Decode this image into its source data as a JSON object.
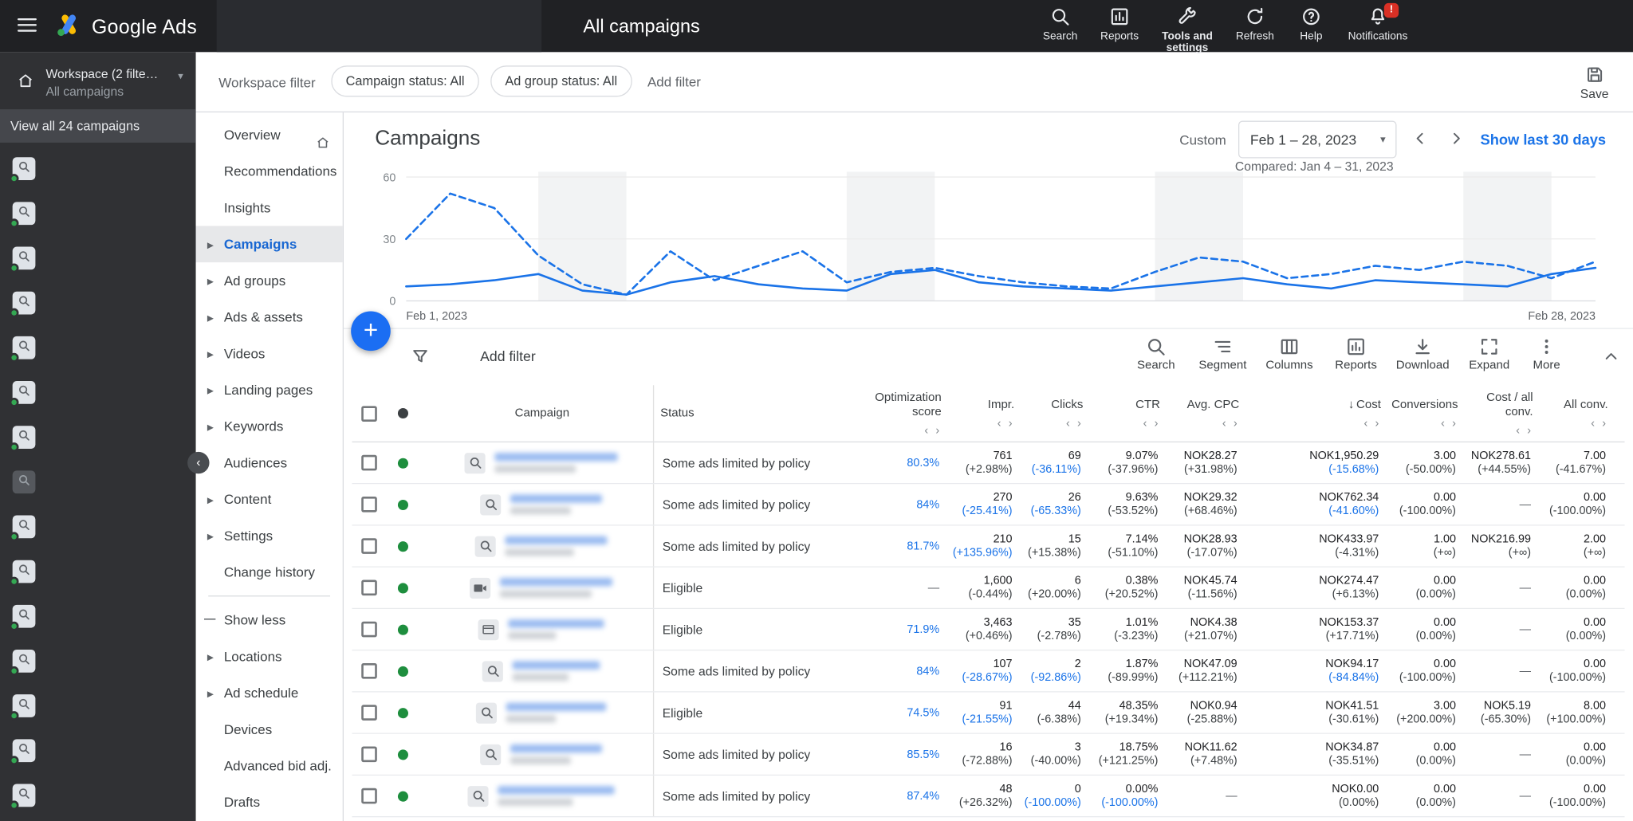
{
  "colors": {
    "accent": "#1a73e8",
    "enabled_green": "#1e8e3e",
    "badge_red": "#d93025"
  },
  "topbar": {
    "brand": "Google Ads",
    "page_title": "All campaigns",
    "actions": [
      {
        "label": "Search"
      },
      {
        "label": "Reports"
      },
      {
        "label": "Tools and settings"
      },
      {
        "label": "Refresh"
      },
      {
        "label": "Help"
      },
      {
        "label": "Notifications",
        "badge": "!"
      }
    ]
  },
  "workspace": {
    "title": "Workspace (2 filte…",
    "subtitle": "All campaigns",
    "view_all": "View all 24 campaigns",
    "thumbnail_count": 15,
    "muted_index": 7
  },
  "filter_bar": {
    "label": "Workspace filter",
    "chips": [
      "Campaign status: All",
      "Ad group status: All"
    ],
    "add_filter": "Add filter",
    "save": "Save"
  },
  "nav": {
    "items": [
      {
        "label": "Overview",
        "home": true
      },
      {
        "label": "Recommendations"
      },
      {
        "label": "Insights"
      },
      {
        "label": "Campaigns",
        "caret": true,
        "selected": true
      },
      {
        "label": "Ad groups",
        "caret": true
      },
      {
        "label": "Ads & assets",
        "caret": true
      },
      {
        "label": "Videos",
        "caret": true
      },
      {
        "label": "Landing pages",
        "caret": true
      },
      {
        "label": "Keywords",
        "caret": true
      },
      {
        "label": "Audiences"
      },
      {
        "label": "Content",
        "caret": true
      },
      {
        "label": "Settings",
        "caret": true
      },
      {
        "label": "Change history"
      },
      {
        "label": "Show less",
        "minus": true,
        "divider_above": true
      },
      {
        "label": "Locations",
        "caret": true
      },
      {
        "label": "Ad schedule",
        "caret": true
      },
      {
        "label": "Devices"
      },
      {
        "label": "Advanced bid adj."
      },
      {
        "label": "Drafts"
      }
    ]
  },
  "header": {
    "title": "Campaigns",
    "date_label": "Custom",
    "date_range": "Feb 1 – 28, 2023",
    "compared": "Compared: Jan 4 – 31, 2023",
    "show_last": "Show last 30 days"
  },
  "chart_data": {
    "type": "line",
    "x_days": 28,
    "x_start_label": "Feb 1, 2023",
    "x_end_label": "Feb 28, 2023",
    "ylim": [
      0,
      60
    ],
    "yticks": [
      0,
      30,
      60
    ],
    "grid": true,
    "weekend_bands_day_idx": [
      [
        3,
        5
      ],
      [
        10,
        12
      ],
      [
        17,
        19
      ],
      [
        24,
        26
      ]
    ],
    "series": [
      {
        "name": "current_period",
        "style": "solid",
        "color": "#1a73e8",
        "values": [
          7,
          8,
          10,
          13,
          5,
          3,
          9,
          12,
          8,
          6,
          5,
          13,
          15,
          9,
          7,
          6,
          5,
          7,
          9,
          11,
          8,
          6,
          10,
          9,
          8,
          7,
          13,
          16
        ]
      },
      {
        "name": "previous_period",
        "style": "dashed",
        "color": "#1a73e8",
        "values": [
          30,
          52,
          45,
          22,
          8,
          3,
          24,
          10,
          17,
          24,
          9,
          14,
          16,
          12,
          9,
          7,
          6,
          14,
          21,
          19,
          11,
          13,
          17,
          15,
          19,
          17,
          11,
          19
        ]
      }
    ]
  },
  "toolbar": {
    "add_filter": "Add filter",
    "tools": [
      "Search",
      "Segment",
      "Columns",
      "Reports",
      "Download",
      "Expand",
      "More"
    ]
  },
  "table": {
    "columns": [
      {
        "id": "campaign",
        "label": "Campaign",
        "align": "left"
      },
      {
        "id": "status",
        "label": "Status",
        "align": "left"
      },
      {
        "id": "opt_score",
        "label": "Optimization score",
        "align": "right",
        "compare": true
      },
      {
        "id": "impr",
        "label": "Impr.",
        "align": "right",
        "compare": true
      },
      {
        "id": "clicks",
        "label": "Clicks",
        "align": "right",
        "compare": true
      },
      {
        "id": "ctr",
        "label": "CTR",
        "align": "right",
        "compare": true
      },
      {
        "id": "cpc",
        "label": "Avg. CPC",
        "align": "right",
        "compare": true
      },
      {
        "id": "cost",
        "label": "Cost",
        "align": "right",
        "compare": true,
        "sorted": "desc"
      },
      {
        "id": "conv",
        "label": "Conversions",
        "align": "right",
        "compare": true
      },
      {
        "id": "cost_all",
        "label": "Cost / all conv.",
        "align": "right",
        "compare": true
      },
      {
        "id": "all_conv",
        "label": "All conv.",
        "align": "right",
        "compare": true
      }
    ],
    "rows": [
      {
        "icon": "search",
        "name_redacted": true,
        "name_w": [
          118,
          78
        ],
        "status": "Some ads limited by policy",
        "opt_score": "80.3%",
        "impr": {
          "v": "761",
          "d": "(+2.98%)"
        },
        "clicks": {
          "v": "69",
          "d": "(-36.11%)",
          "blue": true
        },
        "ctr": {
          "v": "9.07%",
          "d": "(-37.96%)"
        },
        "cpc": {
          "v": "NOK28.27",
          "d": "(+31.98%)"
        },
        "cost": {
          "v": "NOK1,950.29",
          "d": "(-15.68%)",
          "blue": true
        },
        "conv": {
          "v": "3.00",
          "d": "(-50.00%)"
        },
        "cost_all": {
          "v": "NOK278.61",
          "d": "(+44.55%)"
        },
        "all_conv": {
          "v": "7.00",
          "d": "(-41.67%)"
        }
      },
      {
        "icon": "search",
        "name_redacted": true,
        "name_w": [
          88,
          58
        ],
        "status": "Some ads limited by policy",
        "opt_score": "84%",
        "impr": {
          "v": "270",
          "d": "(-25.41%)",
          "blue": true
        },
        "clicks": {
          "v": "26",
          "d": "(-65.33%)",
          "blue": true
        },
        "ctr": {
          "v": "9.63%",
          "d": "(-53.52%)"
        },
        "cpc": {
          "v": "NOK29.32",
          "d": "(+68.46%)"
        },
        "cost": {
          "v": "NOK762.34",
          "d": "(-41.60%)",
          "blue": true
        },
        "conv": {
          "v": "0.00",
          "d": "(-100.00%)"
        },
        "cost_all": "—",
        "all_conv": {
          "v": "0.00",
          "d": "(-100.00%)"
        }
      },
      {
        "icon": "search",
        "name_redacted": true,
        "name_w": [
          98,
          66
        ],
        "status": "Some ads limited by policy",
        "opt_score": "81.7%",
        "impr": {
          "v": "210",
          "d": "(+135.96%)",
          "blue": true
        },
        "clicks": {
          "v": "15",
          "d": "(+15.38%)"
        },
        "ctr": {
          "v": "7.14%",
          "d": "(-51.10%)"
        },
        "cpc": {
          "v": "NOK28.93",
          "d": "(-17.07%)"
        },
        "cost": {
          "v": "NOK433.97",
          "d": "(-4.31%)"
        },
        "conv": {
          "v": "1.00",
          "d": "(+∞)"
        },
        "cost_all": {
          "v": "NOK216.99",
          "d": "(+∞)"
        },
        "all_conv": {
          "v": "2.00",
          "d": "(+∞)"
        }
      },
      {
        "icon": "video",
        "name_redacted": true,
        "name_w": [
          108,
          88
        ],
        "status": "Eligible",
        "opt_score": "—",
        "impr": {
          "v": "1,600",
          "d": "(-0.44%)"
        },
        "clicks": {
          "v": "6",
          "d": "(+20.00%)"
        },
        "ctr": {
          "v": "0.38%",
          "d": "(+20.52%)"
        },
        "cpc": {
          "v": "NOK45.74",
          "d": "(-11.56%)"
        },
        "cost": {
          "v": "NOK274.47",
          "d": "(+6.13%)"
        },
        "conv": {
          "v": "0.00",
          "d": "(0.00%)"
        },
        "cost_all": "—",
        "all_conv": {
          "v": "0.00",
          "d": "(0.00%)"
        }
      },
      {
        "icon": "display",
        "name_redacted": true,
        "name_w": [
          92,
          46
        ],
        "status": "Eligible",
        "opt_score": "71.9%",
        "impr": {
          "v": "3,463",
          "d": "(+0.46%)"
        },
        "clicks": {
          "v": "35",
          "d": "(-2.78%)"
        },
        "ctr": {
          "v": "1.01%",
          "d": "(-3.23%)"
        },
        "cpc": {
          "v": "NOK4.38",
          "d": "(+21.07%)"
        },
        "cost": {
          "v": "NOK153.37",
          "d": "(+17.71%)"
        },
        "conv": {
          "v": "0.00",
          "d": "(0.00%)"
        },
        "cost_all": "—",
        "all_conv": {
          "v": "0.00",
          "d": "(0.00%)"
        }
      },
      {
        "icon": "search",
        "name_redacted": true,
        "name_w": [
          84,
          54
        ],
        "status": "Some ads limited by policy",
        "opt_score": "84%",
        "impr": {
          "v": "107",
          "d": "(-28.67%)",
          "blue": true
        },
        "clicks": {
          "v": "2",
          "d": "(-92.86%)",
          "blue": true
        },
        "ctr": {
          "v": "1.87%",
          "d": "(-89.99%)"
        },
        "cpc": {
          "v": "NOK47.09",
          "d": "(+112.21%)"
        },
        "cost": {
          "v": "NOK94.17",
          "d": "(-84.84%)",
          "blue": true
        },
        "conv": {
          "v": "0.00",
          "d": "(-100.00%)"
        },
        "cost_all": "—",
        "all_conv": {
          "v": "0.00",
          "d": "(-100.00%)"
        }
      },
      {
        "icon": "search",
        "name_redacted": true,
        "name_w": [
          96,
          48
        ],
        "status": "Eligible",
        "opt_score": "74.5%",
        "impr": {
          "v": "91",
          "d": "(-21.55%)",
          "blue": true
        },
        "clicks": {
          "v": "44",
          "d": "(-6.38%)"
        },
        "ctr": {
          "v": "48.35%",
          "d": "(+19.34%)"
        },
        "cpc": {
          "v": "NOK0.94",
          "d": "(-25.88%)"
        },
        "cost": {
          "v": "NOK41.51",
          "d": "(-30.61%)"
        },
        "conv": {
          "v": "3.00",
          "d": "(+200.00%)"
        },
        "cost_all": {
          "v": "NOK5.19",
          "d": "(-65.30%)"
        },
        "all_conv": {
          "v": "8.00",
          "d": "(+100.00%)"
        }
      },
      {
        "icon": "search",
        "name_redacted": true,
        "name_w": [
          88,
          58
        ],
        "status": "Some ads limited by policy",
        "opt_score": "85.5%",
        "impr": {
          "v": "16",
          "d": "(-72.88%)"
        },
        "clicks": {
          "v": "3",
          "d": "(-40.00%)"
        },
        "ctr": {
          "v": "18.75%",
          "d": "(+121.25%)"
        },
        "cpc": {
          "v": "NOK11.62",
          "d": "(+7.48%)"
        },
        "cost": {
          "v": "NOK34.87",
          "d": "(-35.51%)"
        },
        "conv": {
          "v": "0.00",
          "d": "(0.00%)"
        },
        "cost_all": "—",
        "all_conv": {
          "v": "0.00",
          "d": "(0.00%)"
        }
      },
      {
        "icon": "search",
        "name_redacted": true,
        "name_w": [
          112,
          72
        ],
        "status": "Some ads limited by policy",
        "opt_score": "87.4%",
        "impr": {
          "v": "48",
          "d": "(+26.32%)"
        },
        "clicks": {
          "v": "0",
          "d": "(-100.00%)",
          "blue": true
        },
        "ctr": {
          "v": "0.00%",
          "d": "(-100.00%)",
          "blue": true
        },
        "cpc": "—",
        "cost": {
          "v": "NOK0.00",
          "d": "(0.00%)"
        },
        "conv": {
          "v": "0.00",
          "d": "(0.00%)"
        },
        "cost_all": "—",
        "all_conv": {
          "v": "0.00",
          "d": "(-100.00%)"
        }
      }
    ]
  }
}
